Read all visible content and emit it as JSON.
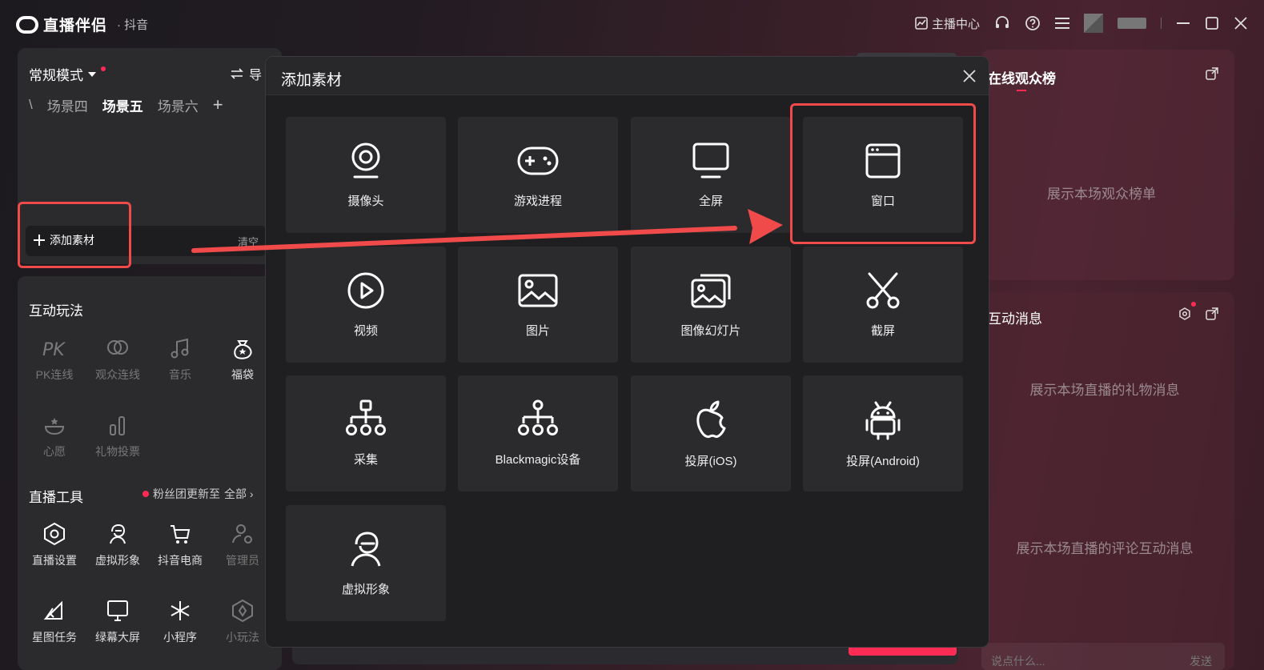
{
  "app": {
    "name": "直播伴侣",
    "platform": "· 抖音",
    "anchor_center": "主播中心"
  },
  "left": {
    "mode": "常规模式",
    "import": "导",
    "scenes": [
      "\\",
      "场景四",
      "场景五",
      "场景六"
    ],
    "scene_add": "+",
    "add_material": "添加素材",
    "clear": "清空",
    "interactive": {
      "title": "互动玩法",
      "items": [
        "PK连线",
        "观众连线",
        "音乐",
        "福袋",
        "心愿",
        "礼物投票"
      ]
    },
    "tools": {
      "title": "直播工具",
      "fans": "粉丝团更新至",
      "all": "全部 ›",
      "items": [
        "直播设置",
        "虚拟形象",
        "抖音电商",
        "管理员",
        "星图任务",
        "绿幕大屏",
        "小程序",
        "小玩法"
      ]
    }
  },
  "right": {
    "rank": {
      "title": "在线观众榜",
      "placeholder": "展示本场观众榜单"
    },
    "msg": {
      "title": "互动消息",
      "gift_placeholder": "展示本场直播的礼物消息",
      "comment_placeholder": "展示本场直播的评论互动消息"
    },
    "input_placeholder": "说点什么...",
    "send": "发送"
  },
  "modal": {
    "title": "添加素材",
    "tiles": [
      {
        "label": "摄像头",
        "icon": "camera-icon"
      },
      {
        "label": "游戏进程",
        "icon": "gamepad-icon"
      },
      {
        "label": "全屏",
        "icon": "monitor-icon"
      },
      {
        "label": "窗口",
        "icon": "window-icon"
      },
      {
        "label": "视频",
        "icon": "play-icon"
      },
      {
        "label": "图片",
        "icon": "image-icon"
      },
      {
        "label": "图像幻灯片",
        "icon": "slideshow-icon"
      },
      {
        "label": "截屏",
        "icon": "scissors-icon"
      },
      {
        "label": "采集",
        "icon": "capture-icon"
      },
      {
        "label": "Blackmagic设备",
        "icon": "blackmagic-icon"
      },
      {
        "label": "投屏(iOS)",
        "icon": "apple-icon"
      },
      {
        "label": "投屏(Android)",
        "icon": "android-icon"
      },
      {
        "label": "虚拟形象",
        "icon": "avatar-icon"
      }
    ]
  },
  "colors": {
    "accent": "#fe2c55",
    "annotation": "#f04a4a"
  }
}
